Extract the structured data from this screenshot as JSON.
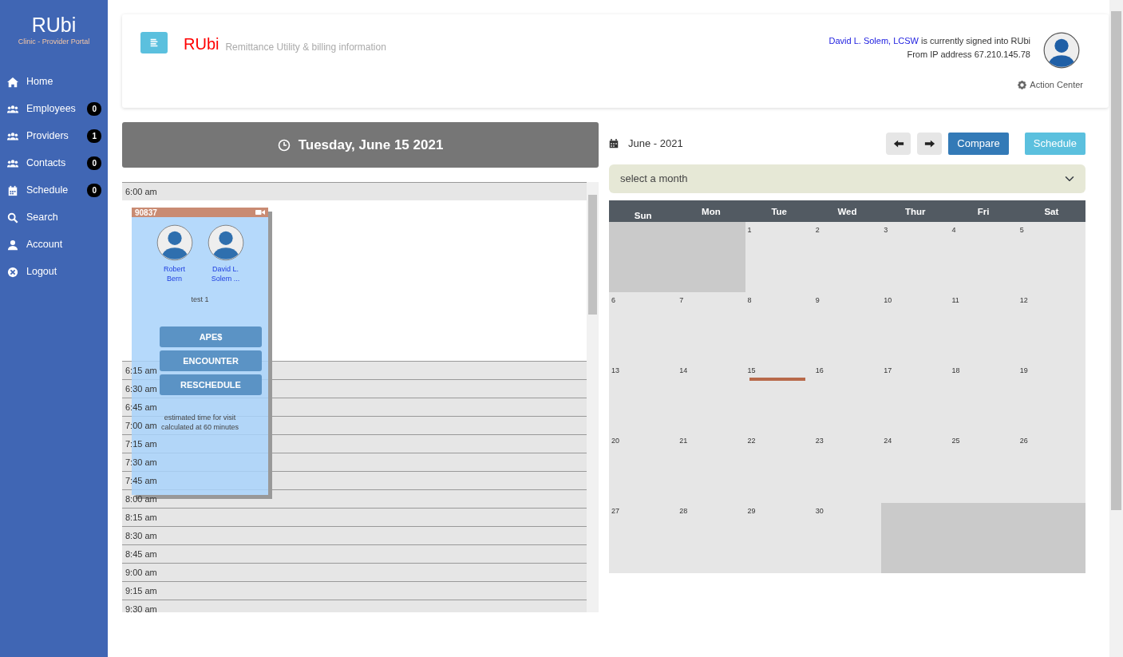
{
  "sidebar": {
    "brand": "RUbi",
    "subtitle": "Clinic - Provider Portal",
    "items": [
      {
        "label": "Home",
        "selected": false
      },
      {
        "label": "Employees",
        "badge": "0",
        "selected": false
      },
      {
        "label": "Providers",
        "badge": "1",
        "selected": false
      },
      {
        "label": "Contacts",
        "badge": "0",
        "selected": false
      },
      {
        "label": "Schedule",
        "badge": "0",
        "selected": false
      },
      {
        "label": "Search",
        "selected": false
      },
      {
        "label": "Account",
        "selected": false
      },
      {
        "label": "Logout",
        "selected": false
      }
    ]
  },
  "header": {
    "app_name": "RUbi",
    "app_subtitle": "Remittance Utility & billing information",
    "user_link": "David L. Solem, LCSW",
    "signed_in_text": " is currently signed into RUbi",
    "ip_text": "From IP address 67.210.145.78",
    "action_center": "Action Center"
  },
  "day_view": {
    "date": "Tuesday, June 15 2021",
    "slots": [
      "6:00 am",
      "6:15 am",
      "6:30 am",
      "6:45 am",
      "7:00 am",
      "7:15 am",
      "7:30 am",
      "7:45 am",
      "8:00 am",
      "8:15 am",
      "8:30 am",
      "8:45 am",
      "9:00 am",
      "9:15 am",
      "9:30 am"
    ],
    "appointment": {
      "code": "90837",
      "participants": [
        {
          "name": "Robert Bern"
        },
        {
          "name": "David L. Solem ..."
        }
      ],
      "note": "test 1",
      "buttons": [
        "APE$",
        "ENCOUNTER",
        "RESCHEDULE"
      ],
      "footer": "estimated time for visit calculated at 60 minutes"
    }
  },
  "month_view": {
    "month": "June - 2021",
    "buttons": [
      {
        "label": "Compare",
        "kind": "primary"
      },
      {
        "label": "Schedule",
        "kind": "info"
      }
    ],
    "month_select": {
      "placeholder": "select a month"
    },
    "weekdays": [
      "Sun",
      "Mon",
      "Tue",
      "Wed",
      "Thur",
      "Fri",
      "Sat"
    ],
    "weeks": [
      [
        {
          "kind": "empty"
        },
        {
          "kind": "empty"
        },
        {
          "kind": "day",
          "day": "1",
          "event": false
        },
        {
          "kind": "day",
          "day": "2",
          "event": false
        },
        {
          "kind": "day",
          "day": "3",
          "event": false
        },
        {
          "kind": "day",
          "day": "4",
          "event": false
        },
        {
          "kind": "day",
          "day": "5",
          "event": false
        }
      ],
      [
        {
          "kind": "day",
          "day": "6",
          "event": false
        },
        {
          "kind": "day",
          "day": "7",
          "event": false
        },
        {
          "kind": "day",
          "day": "8",
          "event": false
        },
        {
          "kind": "day",
          "day": "9",
          "event": false
        },
        {
          "kind": "day",
          "day": "10",
          "event": false
        },
        {
          "kind": "day",
          "day": "11",
          "event": false
        },
        {
          "kind": "day",
          "day": "12",
          "event": false
        }
      ],
      [
        {
          "kind": "day",
          "day": "13",
          "event": false
        },
        {
          "kind": "day",
          "day": "14",
          "event": false
        },
        {
          "kind": "day",
          "day": "15",
          "event": true
        },
        {
          "kind": "day",
          "day": "16",
          "event": false
        },
        {
          "kind": "day",
          "day": "17",
          "event": false
        },
        {
          "kind": "day",
          "day": "18",
          "event": false
        },
        {
          "kind": "day",
          "day": "19",
          "event": false
        }
      ],
      [
        {
          "kind": "day",
          "day": "20",
          "event": false
        },
        {
          "kind": "day",
          "day": "21",
          "event": false
        },
        {
          "kind": "day",
          "day": "22",
          "event": false
        },
        {
          "kind": "day",
          "day": "23",
          "event": false
        },
        {
          "kind": "day",
          "day": "24",
          "event": false
        },
        {
          "kind": "day",
          "day": "25",
          "event": false
        },
        {
          "kind": "day",
          "day": "26",
          "event": false
        }
      ],
      [
        {
          "kind": "day",
          "day": "27",
          "event": false
        },
        {
          "kind": "day",
          "day": "28",
          "event": false
        },
        {
          "kind": "day",
          "day": "29",
          "event": false
        },
        {
          "kind": "day",
          "day": "30",
          "event": false
        },
        {
          "kind": "empty"
        },
        {
          "kind": "empty"
        },
        {
          "kind": "empty"
        }
      ]
    ]
  }
}
